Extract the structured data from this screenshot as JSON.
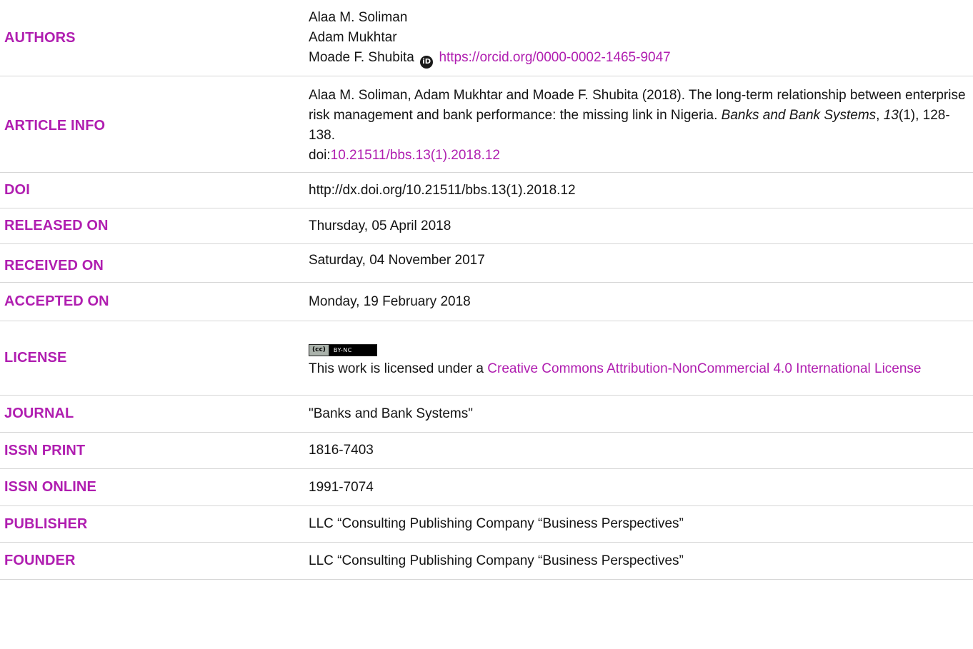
{
  "rows": {
    "authors": {
      "label": "AUTHORS",
      "names": [
        "Alaa M. Soliman",
        "Adam Mukhtar",
        "Moade F. Shubita"
      ],
      "orcid_icon": "orcid-icon",
      "orcid_url": "https://orcid.org/0000-0002-1465-9047"
    },
    "article_info": {
      "label": "ARTICLE INFO",
      "citation_text": "Alaa M. Soliman, Adam Mukhtar and Moade F. Shubita (2018). The long-term relationship between enterprise risk management and bank performance: the missing link in Nigeria. ",
      "journal_italic": "Banks and Bank Systems",
      "sep1": ", ",
      "volume_italic": "13",
      "issue_pages": "(1), 128-138.",
      "doi_prefix": "doi:",
      "doi_link": "10.21511/bbs.13(1).2018.12"
    },
    "doi": {
      "label": "DOI",
      "value": "http://dx.doi.org/10.21511/bbs.13(1).2018.12"
    },
    "released_on": {
      "label": "RELEASED ON",
      "value": "Thursday, 05 April 2018"
    },
    "received_on": {
      "label": "RECEIVED ON",
      "value": "Saturday, 04 November 2017"
    },
    "accepted_on": {
      "label": "ACCEPTED ON",
      "value": "Monday, 19 February 2018"
    },
    "license": {
      "label": "LICENSE",
      "badge_left": "(cc)",
      "badge_right": "BY-NC",
      "text_prefix": "This work is licensed under a ",
      "link_text": "Creative Commons Attribution-NonCommercial 4.0 International License"
    },
    "journal": {
      "label": "JOURNAL",
      "value": "\"Banks and Bank Systems\""
    },
    "issn_print": {
      "label": "ISSN PRINT",
      "value": "1816-7403"
    },
    "issn_online": {
      "label": "ISSN ONLINE",
      "value": "1991-7074"
    },
    "publisher": {
      "label": "PUBLISHER",
      "value": "LLC “Consulting Publishing Company “Business Perspectives”"
    },
    "founder": {
      "label": "FOUNDER",
      "value": "LLC “Consulting Publishing Company “Business Perspectives”"
    }
  },
  "colors": {
    "label": "#b01eb0",
    "link": "#b01eb0",
    "text": "#141414",
    "divider": "#d6d6d6"
  }
}
